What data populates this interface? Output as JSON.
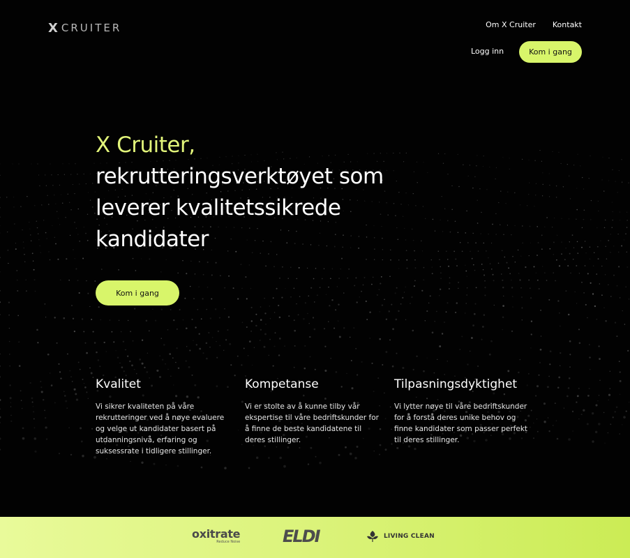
{
  "header": {
    "logo_mark": "X",
    "logo_text": "CRUITER",
    "nav": [
      "Om X Cruiter",
      "Kontakt"
    ],
    "login_label": "Logg inn",
    "cta_label": "Kom i gang"
  },
  "hero": {
    "title_accent": "X Cruiter,",
    "title_rest": "rekrutteringsverktøyet som leverer kvalitetssikrede kandidater",
    "cta_label": "Kom i gang"
  },
  "features": [
    {
      "title": "Kvalitet",
      "text": "Vi sikrer kvaliteten på våre rekrutteringer ved å nøye evaluere og velge ut kandidater basert på utdanningsnivå, erfaring og suksessrate i tidligere stillinger."
    },
    {
      "title": "Kompetanse",
      "text": "Vi er stolte av å kunne tilby vår ekspertise til våre bedriftskunder for å finne de beste kandidatene til deres stillinger."
    },
    {
      "title": "Tilpasningsdyktighet",
      "text": "Vi lytter nøye til våre bedriftskunder for å forstå deres unike behov og finne kandidater som passer perfekt til deres stillinger."
    }
  ],
  "partners": {
    "oxitrate": "oxitrate",
    "oxitrate_tagline": "Reduce Noise",
    "eldi": "ELDI",
    "living_clean": "LIVING CLEAN"
  },
  "colors": {
    "background": "#020202",
    "accent": "#d8f56a",
    "accent_text": "#e2f57a"
  }
}
